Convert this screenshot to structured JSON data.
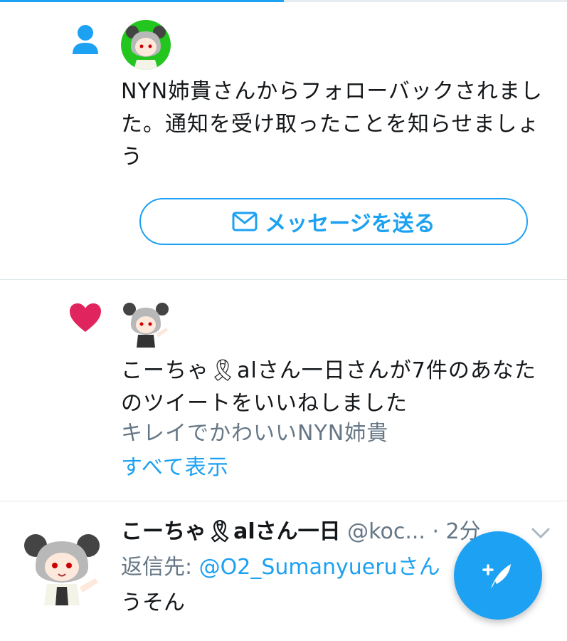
{
  "notifications": [
    {
      "type": "follow",
      "icon": "person-icon",
      "text": "NYN姉貴さんからフォローバックされました。通知を受け取ったことを知らせましょう",
      "button_label": "メッセージを送る"
    },
    {
      "type": "like",
      "icon": "heart-icon",
      "text": "こーちゃ🎗alさん一日さんが7件のあなたのツイートをいいねしました",
      "preview": "キレイでかわいいNYN姉貴",
      "show_all": "すべて表示"
    }
  ],
  "tweet": {
    "display_name": "こーちゃ🎗alさん一日",
    "handle": "@koc...",
    "time": "· 2分",
    "reply_label": "返信先:",
    "reply_target": "@O2_Sumanyueruさん",
    "body": "うそん"
  },
  "compose": {
    "icon": "compose-feather-icon"
  },
  "colors": {
    "accent": "#1da1f2",
    "like": "#e0245e",
    "text": "#14171a",
    "muted": "#657786"
  },
  "progress": 0.5
}
